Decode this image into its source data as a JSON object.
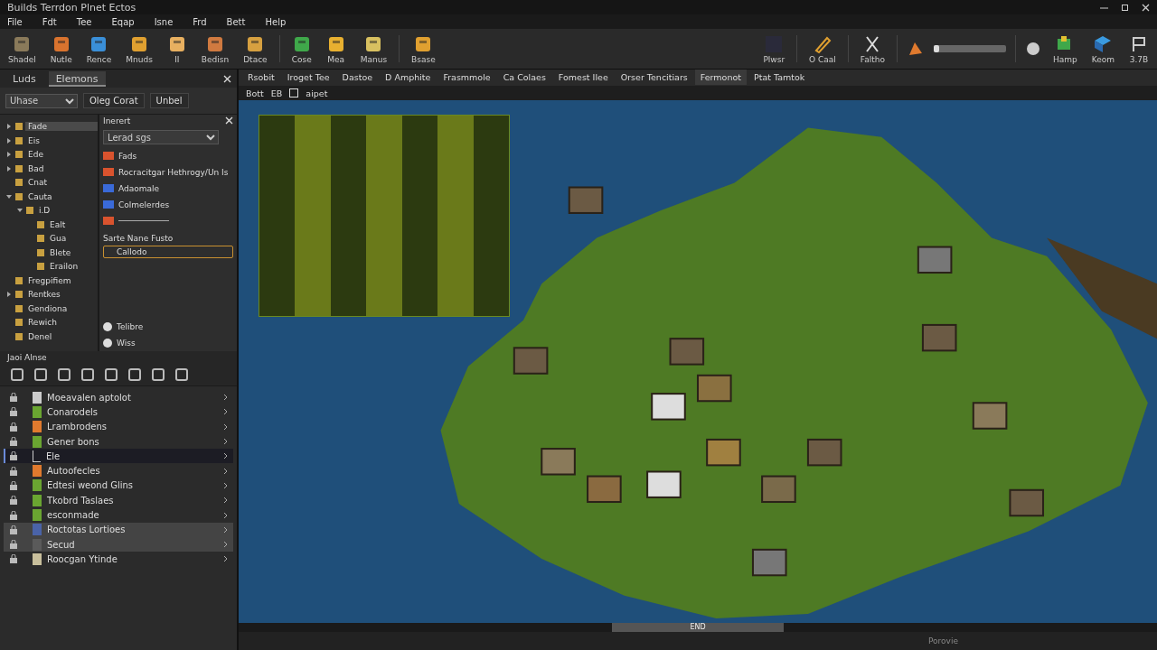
{
  "window": {
    "title": "Builds Terrdon Plnet Ectos"
  },
  "menu": [
    "File",
    "Fdt",
    "Tee",
    "Eqap",
    "Isne",
    "Frd",
    "Bett",
    "Help"
  ],
  "toolbar": {
    "left": [
      {
        "label": "Shadel"
      },
      {
        "label": "Nutle"
      },
      {
        "label": "Rence"
      },
      {
        "label": "Mnuds"
      },
      {
        "label": "II"
      },
      {
        "label": "Bedisn"
      },
      {
        "label": "Dtace"
      },
      {
        "label": "Cose"
      },
      {
        "label": "Mea"
      },
      {
        "label": "Manus"
      },
      {
        "label": "Bsase"
      }
    ],
    "right": [
      {
        "label": "Plwsr"
      },
      {
        "label": "O Caal"
      },
      {
        "label": "Faltho"
      }
    ],
    "zoom_slider": {
      "level": 0.08
    },
    "far_right": [
      {
        "label": "Hamp"
      },
      {
        "label": "Keom"
      },
      {
        "label": "3.7B"
      }
    ]
  },
  "left_panel": {
    "tabs": [
      {
        "label": "Luds",
        "selected": false
      },
      {
        "label": "Elemons",
        "selected": true
      }
    ],
    "dropdown": {
      "value": "Uhase"
    },
    "buttons": [
      "Oleg Corat",
      "Unbel"
    ],
    "tree": [
      {
        "label": "Fade",
        "selected": true,
        "expanded": false
      },
      {
        "label": "Eis",
        "selected": false,
        "expanded": false
      },
      {
        "label": "Ede",
        "selected": false,
        "expanded": false
      },
      {
        "label": "Bad",
        "selected": false,
        "expanded": false
      },
      {
        "label": "Cnat",
        "selected": false
      },
      {
        "label": "Cauta",
        "selected": false,
        "expanded": true,
        "children": [
          {
            "label": "i.D",
            "selected": false,
            "expanded": true,
            "children": [
              {
                "label": "Ealt",
                "selected": false
              },
              {
                "label": "Gua",
                "selected": false
              },
              {
                "label": "Blete",
                "selected": false
              },
              {
                "label": "Erailon",
                "selected": false
              }
            ]
          }
        ]
      },
      {
        "label": "Fregpifiem",
        "selected": false
      },
      {
        "label": "Rentkes",
        "selected": false,
        "expanded": false
      },
      {
        "label": "Gendiona",
        "selected": false
      },
      {
        "label": "Rewich",
        "selected": false
      },
      {
        "label": "Denel",
        "selected": false
      }
    ],
    "inspector": {
      "title": "Inerert",
      "dropdown": "Lerad sgs",
      "items": [
        "Fads",
        "Rocracitgar Hethrogy/Un Is",
        "Adaomale",
        "Colmelerdes"
      ],
      "section": "Sarte Nane Fusto",
      "field": "Callodo",
      "options": [
        "Telibre",
        "Wiss"
      ]
    },
    "status": "Jaoi Alnse"
  },
  "layers": [
    {
      "label": "Moeavalen aptolot",
      "kind": "file",
      "selected": false,
      "highlighted": false
    },
    {
      "label": "Conarodels",
      "kind": "swatch",
      "color": "#6aa531",
      "selected": false,
      "highlighted": false
    },
    {
      "label": "Lrambrodens",
      "kind": "swatch",
      "color": "#e07a2e",
      "selected": false,
      "highlighted": false
    },
    {
      "label": "Gener bons",
      "kind": "swatch",
      "color": "#6aa531",
      "selected": false,
      "highlighted": false
    },
    {
      "label": "Ele",
      "kind": "empty",
      "selected": true,
      "highlighted": false
    },
    {
      "label": "Autoofecles",
      "kind": "swatch",
      "color": "#e07a2e",
      "selected": false,
      "highlighted": false
    },
    {
      "label": "Edtesi weond Glins",
      "kind": "swatch",
      "color": "#6aa531",
      "selected": false,
      "highlighted": false
    },
    {
      "label": "Tkobrd Taslaes",
      "kind": "swatch",
      "color": "#6aa531",
      "selected": false,
      "highlighted": false
    },
    {
      "label": "esconmade",
      "kind": "swatch",
      "color": "#6aa531",
      "selected": false,
      "highlighted": false
    },
    {
      "label": "Roctotas Lortioes",
      "kind": "swatch",
      "color": "#4a63a8",
      "selected": false,
      "highlighted": true
    },
    {
      "label": "Secud",
      "kind": "swatch",
      "color": "#5a5a5a",
      "selected": false,
      "highlighted": true
    },
    {
      "label": "Roocgan Ytinde",
      "kind": "swatch",
      "color": "#c8bf9c",
      "selected": false,
      "highlighted": false
    }
  ],
  "map_tabs": [
    {
      "label": "Rsobit",
      "selected": false
    },
    {
      "label": "Iroget Tee",
      "selected": false
    },
    {
      "label": "Dastoe",
      "selected": false
    },
    {
      "label": "D Amphite",
      "selected": false
    },
    {
      "label": "Frasmmole",
      "selected": false
    },
    {
      "label": "Ca Colaes",
      "selected": false
    },
    {
      "label": "Fomest Ilee",
      "selected": false
    },
    {
      "label": "Orser Tencitiars",
      "selected": false
    },
    {
      "label": "Fermonot",
      "selected": true
    },
    {
      "label": "Ptat Tamtok",
      "selected": false
    }
  ],
  "map_toolbar": {
    "items": [
      "Bott",
      "EB"
    ],
    "checkbox": {
      "label": "aipet",
      "checked": false
    }
  },
  "map_scrollbar": {
    "label": "END"
  },
  "status_bar": "Porovie"
}
